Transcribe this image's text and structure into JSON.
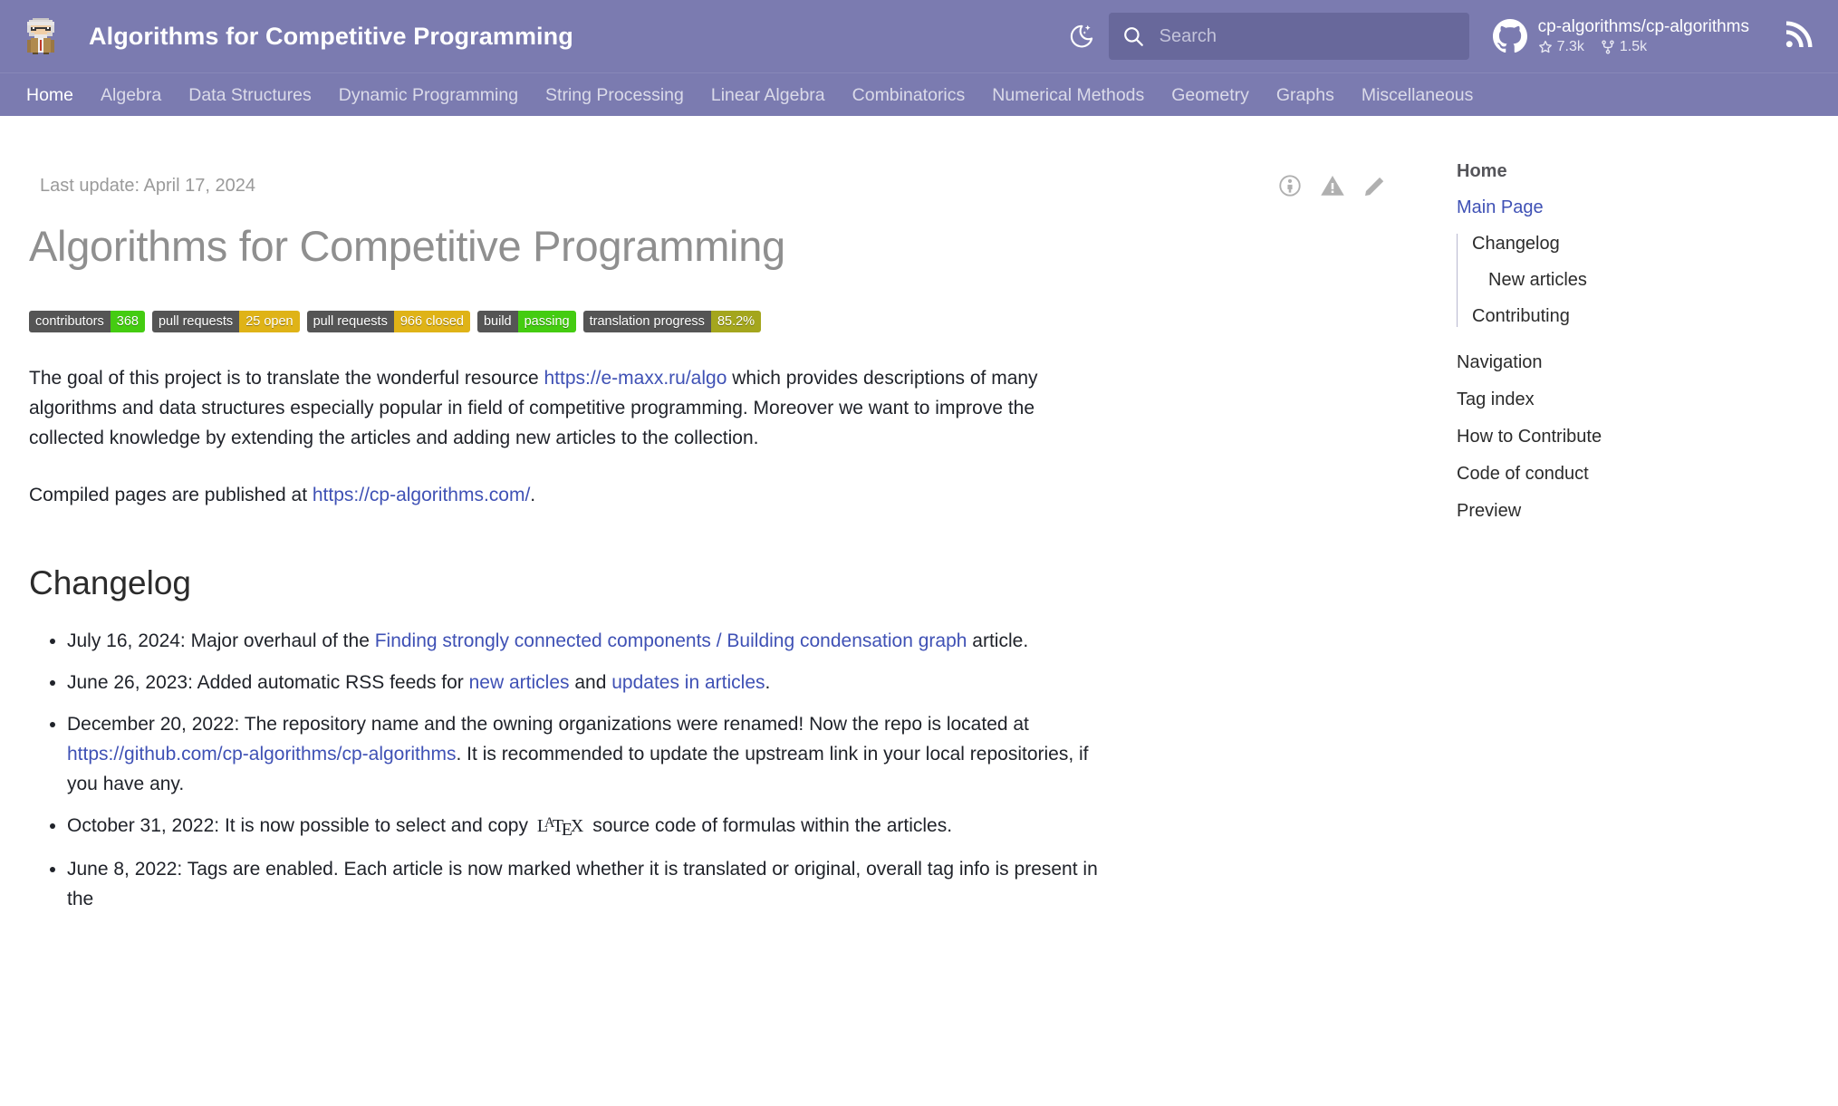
{
  "header": {
    "logo_icon": "einstein-pixel-logo",
    "site_title": "Algorithms for Competitive Programming",
    "theme_toggle_icon": "moon-star-icon",
    "search": {
      "icon": "search-icon",
      "placeholder": "Search",
      "value": ""
    },
    "repo": {
      "icon": "github-icon",
      "name": "cp-algorithms/cp-algorithms",
      "stars_icon": "star-icon",
      "stars": "7.3k",
      "forks_icon": "fork-icon",
      "forks": "1.5k"
    },
    "rss_icon": "rss-icon",
    "bg_color": "#7b7bb0"
  },
  "nav": {
    "tabs": [
      {
        "label": "Home",
        "active": true
      },
      {
        "label": "Algebra",
        "active": false
      },
      {
        "label": "Data Structures",
        "active": false
      },
      {
        "label": "Dynamic Programming",
        "active": false
      },
      {
        "label": "String Processing",
        "active": false
      },
      {
        "label": "Linear Algebra",
        "active": false
      },
      {
        "label": "Combinatorics",
        "active": false
      },
      {
        "label": "Numerical Methods",
        "active": false
      },
      {
        "label": "Geometry",
        "active": false
      },
      {
        "label": "Graphs",
        "active": false
      },
      {
        "label": "Miscellaneous",
        "active": false
      }
    ]
  },
  "main": {
    "last_update": "Last update: April 17, 2024",
    "meta_icons": [
      {
        "name": "authors-icon"
      },
      {
        "name": "warning-triangle-icon"
      },
      {
        "name": "edit-pencil-icon"
      }
    ],
    "page_title": "Algorithms for Competitive Programming",
    "badges": [
      {
        "label": "contributors",
        "value": "368",
        "value_color": "#4c1",
        "label_color": "#555"
      },
      {
        "label": "pull requests",
        "value": "25 open",
        "value_color": "#dfb317",
        "label_color": "#555"
      },
      {
        "label": "pull requests",
        "value": "966 closed",
        "value_color": "#dfb317",
        "label_color": "#555"
      },
      {
        "label": "build",
        "value": "passing",
        "value_color": "#4c1",
        "label_color": "#555"
      },
      {
        "label": "translation progress",
        "value": "85.2%",
        "value_color": "#a4a61d",
        "label_color": "#555"
      }
    ],
    "paragraph1": {
      "part1": "The goal of this project is to translate the wonderful resource ",
      "link1": "https://e-maxx.ru/algo",
      "part2": " which provides descriptions of many algorithms and data structures especially popular in field of competitive programming. Moreover we want to improve the collected knowledge by extending the articles and adding new articles to the collection."
    },
    "paragraph2": {
      "part1": "Compiled pages are published at ",
      "link1": "https://cp-algorithms.com/",
      "part2": "."
    },
    "changelog_heading": "Changelog",
    "changelog": [
      {
        "part1": "July 16, 2024: Major overhaul of the ",
        "link1": "Finding strongly connected components / Building condensation graph",
        "part2": " article.",
        "link2": "",
        "part3": ""
      },
      {
        "part1": "June 26, 2023: Added automatic RSS feeds for ",
        "link1": "new articles",
        "part2": " and ",
        "link2": "updates in articles",
        "part3": "."
      },
      {
        "part1": "December 20, 2022: The repository name and the owning organizations were renamed! Now the repo is located at ",
        "link1": "https://github.com/cp-algorithms/cp-algorithms",
        "part2": ". It is recommended to update the upstream link in your local repositories, if you have any.",
        "link2": "",
        "part3": ""
      },
      {
        "part1": "October 31, 2022: It is now possible to select and copy ",
        "latex": "LaTeX",
        "part2": " source code of formulas within the articles.",
        "link1": "",
        "link2": "",
        "part3": ""
      },
      {
        "part1": "June 8, 2022: Tags are enabled. Each article is now marked whether it is translated or original, overall tag info is present in the",
        "link1": "",
        "part2": "",
        "link2": "",
        "part3": ""
      }
    ]
  },
  "toc": {
    "heading": "Home",
    "main_link": {
      "label": "Main Page",
      "active": true
    },
    "sub_items": [
      {
        "label": "Changelog",
        "level": 2
      },
      {
        "label": "New articles",
        "level": 3
      },
      {
        "label": "Contributing",
        "level": 2
      }
    ],
    "group_items": [
      {
        "label": "Navigation"
      },
      {
        "label": "Tag index"
      },
      {
        "label": "How to Contribute"
      },
      {
        "label": "Code of conduct"
      },
      {
        "label": "Preview"
      }
    ]
  }
}
